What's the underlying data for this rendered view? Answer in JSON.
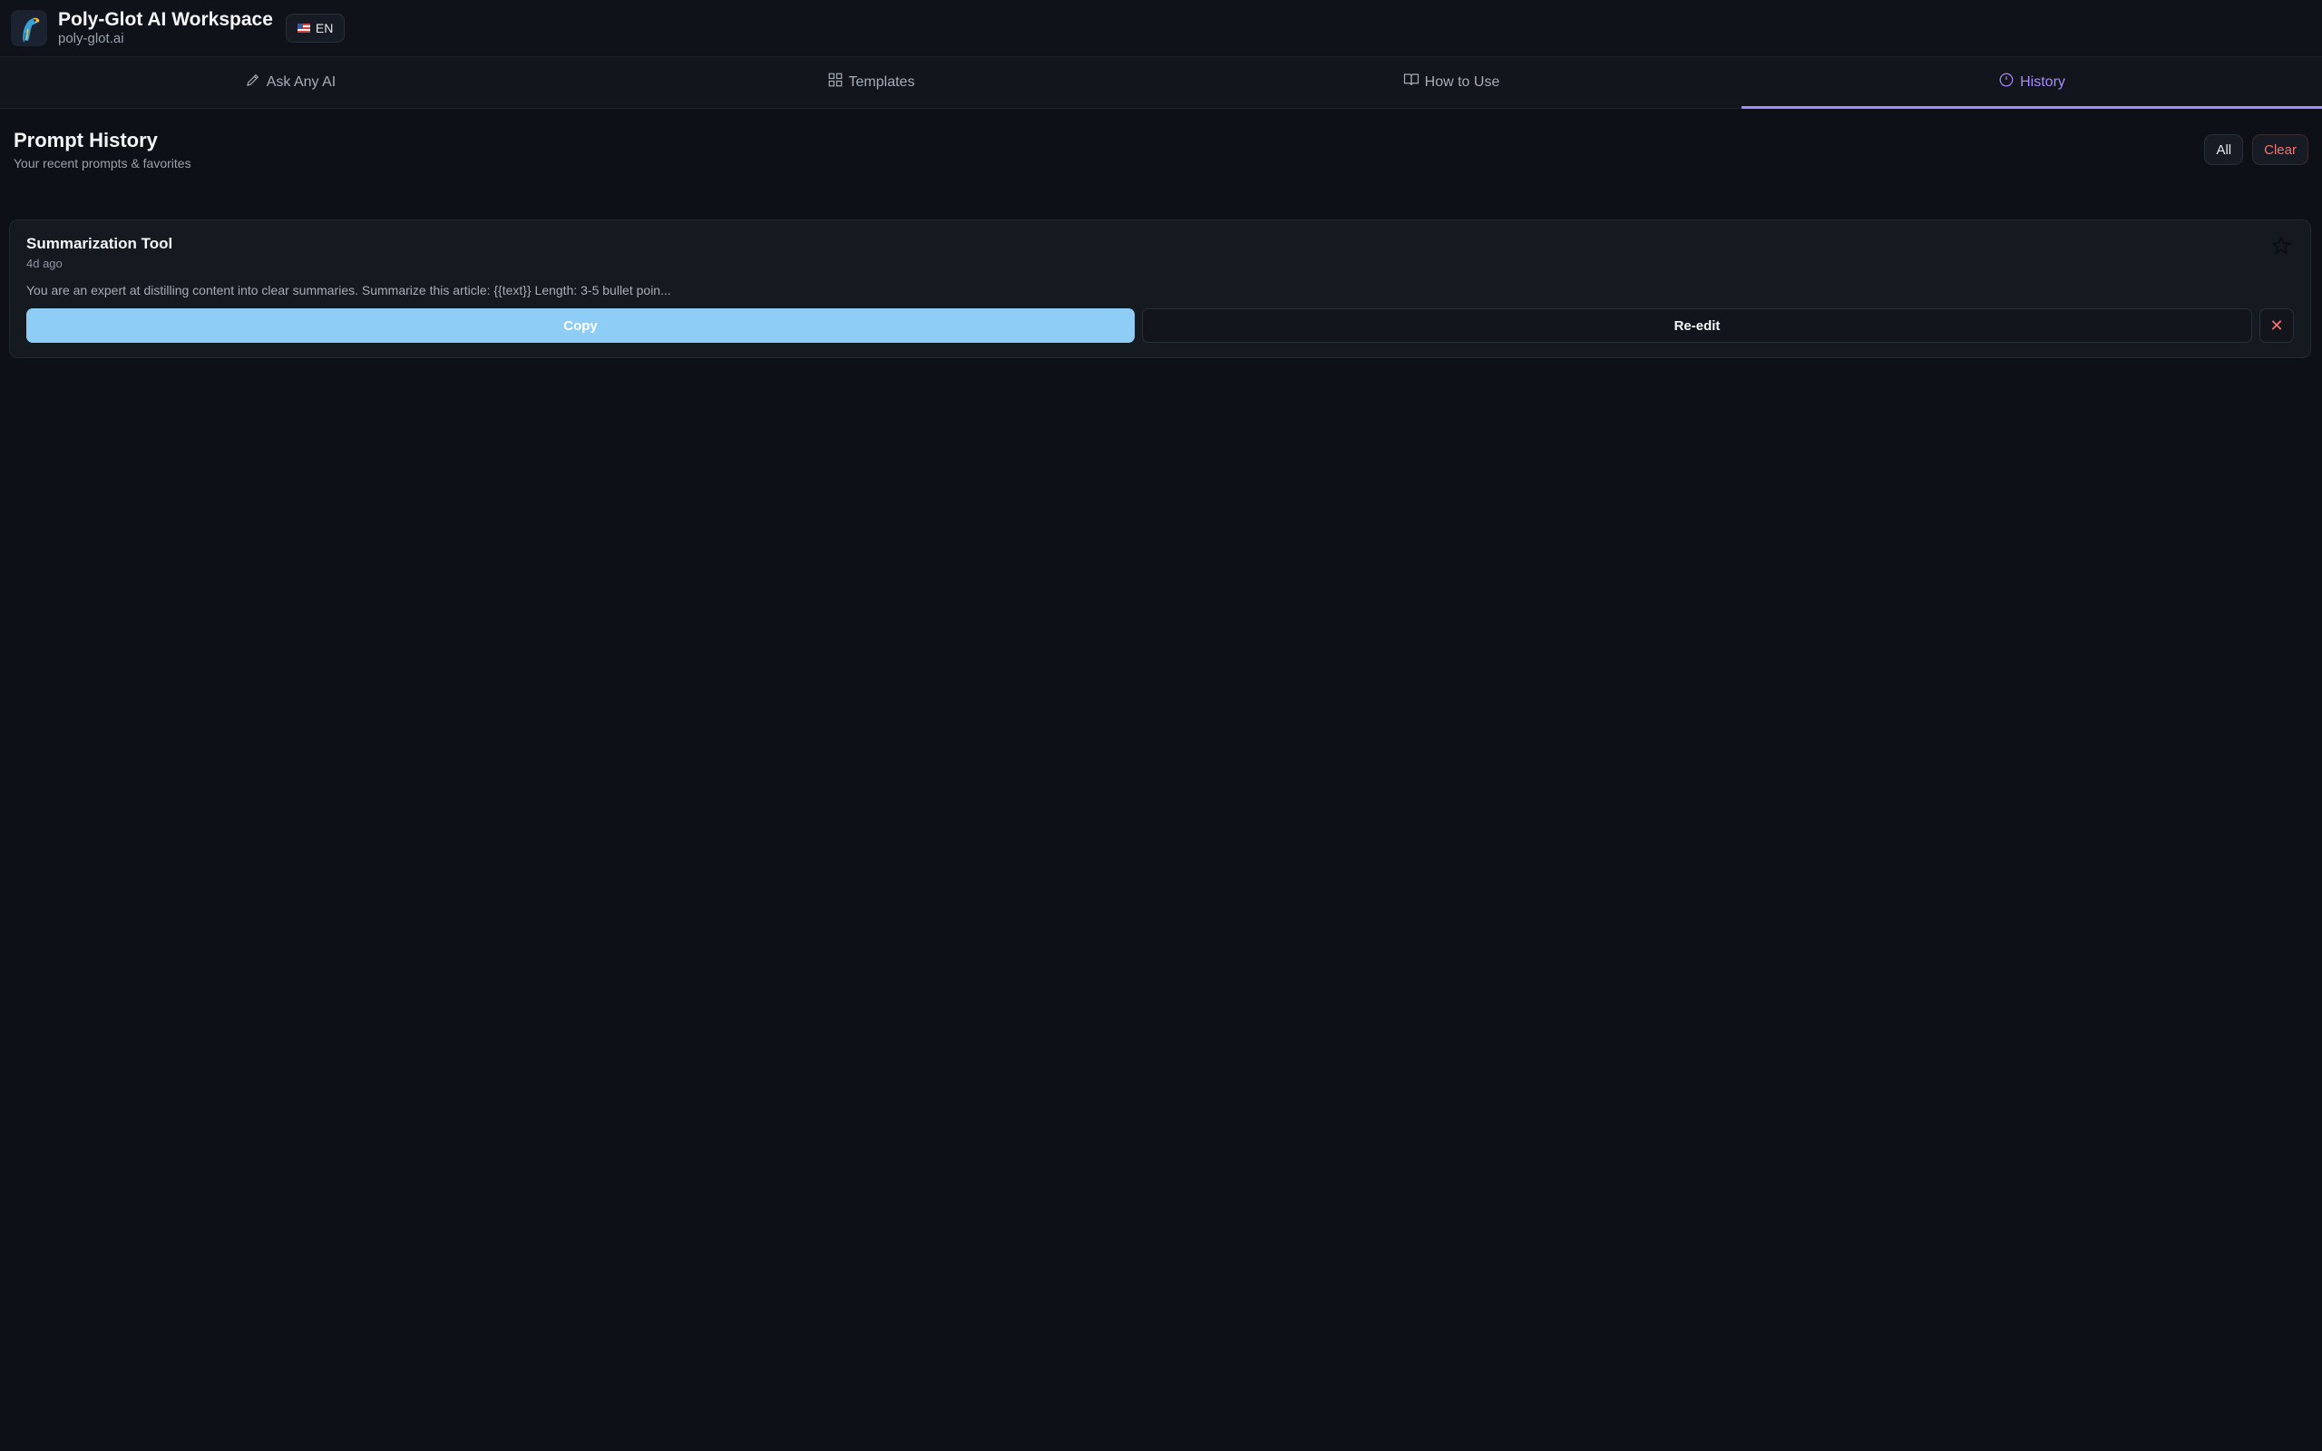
{
  "app": {
    "title": "Poly-Glot AI Workspace",
    "subtitle": "poly-glot.ai",
    "logo_icon": "parrot-logo-icon",
    "language": "EN",
    "language_flag": "us-flag-icon"
  },
  "tabs": [
    {
      "label": "Ask Any AI",
      "icon": "pencil-icon",
      "active": false
    },
    {
      "label": "Templates",
      "icon": "grid-icon",
      "active": false
    },
    {
      "label": "How to Use",
      "icon": "book-icon",
      "active": false
    },
    {
      "label": "History",
      "icon": "clock-icon",
      "active": true
    }
  ],
  "history": {
    "title": "Prompt History",
    "subtitle": "Your recent prompts & favorites",
    "filter_all": "All",
    "clear": "Clear",
    "items": [
      {
        "title": "Summarization Tool",
        "time": "4d ago",
        "preview": "You are an expert at distilling content into clear summaries. Summarize this article: {{text}} Length: 3-5 bullet poin...",
        "copy_label": "Copy",
        "reedit_label": "Re-edit",
        "delete_label": "✕",
        "favorite": false
      }
    ]
  },
  "colors": {
    "accent": "#a78bfa",
    "copy_button": "#8ecdf6",
    "danger": "#f87171",
    "background": "#0d1016"
  }
}
